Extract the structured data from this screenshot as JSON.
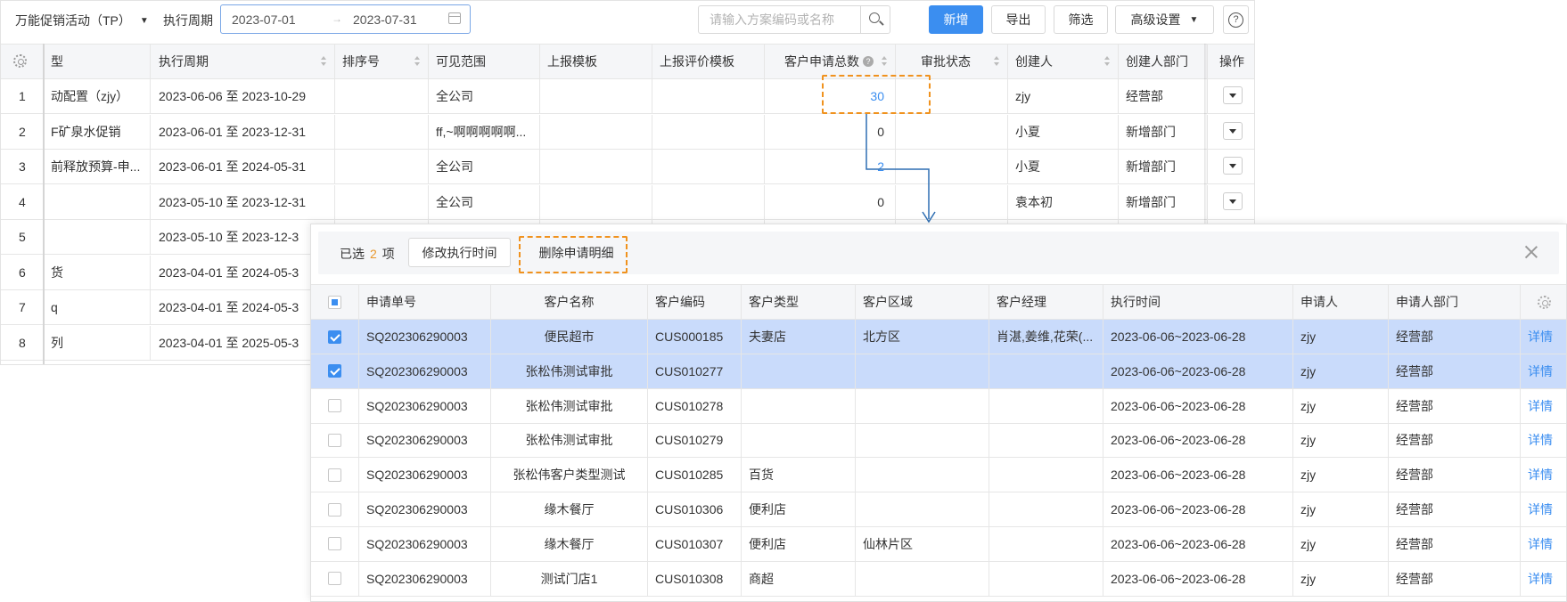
{
  "toolbar": {
    "activity_select": "万能促销活动（TP）",
    "period_label": "执行周期",
    "date_start": "2023-07-01",
    "date_arrow": "→",
    "date_end": "2023-07-31",
    "search_placeholder": "请输入方案编码或名称",
    "btn_new": "新增",
    "btn_export": "导出",
    "btn_filter": "筛选",
    "btn_advanced": "高级设置",
    "help_glyph": "?"
  },
  "main_table": {
    "columns": [
      "型",
      "执行周期",
      "排序号",
      "可见范围",
      "上报模板",
      "上报评价模板",
      "客户申请总数",
      "审批状态",
      "创建人",
      "创建人部门",
      "操作"
    ],
    "rows": [
      {
        "no": "1",
        "type": "动配置（zjy）",
        "period": "2023-06-06 至 2023-10-29",
        "sort": "",
        "scope": "全公司",
        "tpl": "",
        "eval_tpl": "",
        "total": "30",
        "status": "",
        "creator": "zjy",
        "dept": "经营部"
      },
      {
        "no": "2",
        "type": "F矿泉水促销",
        "period": "2023-06-01 至 2023-12-31",
        "sort": "",
        "scope": "ff,~啊啊啊啊啊...",
        "tpl": "",
        "eval_tpl": "",
        "total": "0",
        "status": "",
        "creator": "小夏",
        "dept": "新增部门"
      },
      {
        "no": "3",
        "type": "前释放预算-申...",
        "period": "2023-06-01 至 2024-05-31",
        "sort": "",
        "scope": "全公司",
        "tpl": "",
        "eval_tpl": "",
        "total": "2",
        "status": "",
        "creator": "小夏",
        "dept": "新增部门"
      },
      {
        "no": "4",
        "type": "",
        "period": "2023-05-10 至 2023-12-31",
        "sort": "",
        "scope": "全公司",
        "tpl": "",
        "eval_tpl": "",
        "total": "0",
        "status": "",
        "creator": "袁本初",
        "dept": "新增部门"
      },
      {
        "no": "5",
        "type": "",
        "period": "2023-05-10 至 2023-12-3",
        "sort": "",
        "scope": "",
        "tpl": "",
        "eval_tpl": "",
        "total": "",
        "status": "",
        "creator": "",
        "dept": ""
      },
      {
        "no": "6",
        "type": "货",
        "period": "2023-04-01 至 2024-05-3",
        "sort": "",
        "scope": "",
        "tpl": "",
        "eval_tpl": "",
        "total": "",
        "status": "",
        "creator": "",
        "dept": ""
      },
      {
        "no": "7",
        "type": "q",
        "period": "2023-04-01 至 2024-05-3",
        "sort": "",
        "scope": "",
        "tpl": "",
        "eval_tpl": "",
        "total": "",
        "status": "",
        "creator": "",
        "dept": ""
      },
      {
        "no": "8",
        "type": "列",
        "period": "2023-04-01 至 2025-05-3",
        "sort": "",
        "scope": "",
        "tpl": "",
        "eval_tpl": "",
        "total": "",
        "status": "",
        "creator": "",
        "dept": ""
      }
    ]
  },
  "batch_bar": {
    "selected_prefix": "已选",
    "selected_count": "2",
    "selected_suffix": "项",
    "btn_modify_time": "修改执行时间",
    "btn_delete_detail": "删除申请明细"
  },
  "detail_table": {
    "columns": [
      "申请单号",
      "客户名称",
      "客户编码",
      "客户类型",
      "客户区域",
      "客户经理",
      "执行时间",
      "申请人",
      "申请人部门"
    ],
    "rows": [
      {
        "checked": true,
        "no": "SQ202306290003",
        "name": "便民超市",
        "code": "CUS000185",
        "ctype": "夫妻店",
        "region": "北方区",
        "manager": "肖湛,姜维,花荣(...",
        "time": "2023-06-06~2023-06-28",
        "applicant": "zjy",
        "dept": "经营部",
        "action": "详情"
      },
      {
        "checked": true,
        "no": "SQ202306290003",
        "name": "张松伟测试审批",
        "code": "CUS010277",
        "ctype": "",
        "region": "",
        "manager": "",
        "time": "2023-06-06~2023-06-28",
        "applicant": "zjy",
        "dept": "经营部",
        "action": "详情"
      },
      {
        "checked": false,
        "no": "SQ202306290003",
        "name": "张松伟测试审批",
        "code": "CUS010278",
        "ctype": "",
        "region": "",
        "manager": "",
        "time": "2023-06-06~2023-06-28",
        "applicant": "zjy",
        "dept": "经营部",
        "action": "详情"
      },
      {
        "checked": false,
        "no": "SQ202306290003",
        "name": "张松伟测试审批",
        "code": "CUS010279",
        "ctype": "",
        "region": "",
        "manager": "",
        "time": "2023-06-06~2023-06-28",
        "applicant": "zjy",
        "dept": "经营部",
        "action": "详情"
      },
      {
        "checked": false,
        "no": "SQ202306290003",
        "name": "张松伟客户类型测试",
        "code": "CUS010285",
        "ctype": "百货",
        "region": "",
        "manager": "",
        "time": "2023-06-06~2023-06-28",
        "applicant": "zjy",
        "dept": "经营部",
        "action": "详情"
      },
      {
        "checked": false,
        "no": "SQ202306290003",
        "name": "缘木餐厅",
        "code": "CUS010306",
        "ctype": "便利店",
        "region": "",
        "manager": "",
        "time": "2023-06-06~2023-06-28",
        "applicant": "zjy",
        "dept": "经营部",
        "action": "详情"
      },
      {
        "checked": false,
        "no": "SQ202306290003",
        "name": "缘木餐厅",
        "code": "CUS010307",
        "ctype": "便利店",
        "region": "仙林片区",
        "manager": "",
        "time": "2023-06-06~2023-06-28",
        "applicant": "zjy",
        "dept": "经营部",
        "action": "详情"
      },
      {
        "checked": false,
        "no": "SQ202306290003",
        "name": "测试门店1",
        "code": "CUS010308",
        "ctype": "商超",
        "region": "",
        "manager": "",
        "time": "2023-06-06~2023-06-28",
        "applicant": "zjy",
        "dept": "经营部",
        "action": "详情"
      }
    ]
  },
  "colors": {
    "primary": "#3b8ef0",
    "selected_row": "#c9dbfb",
    "annotation": "#f0921e",
    "connector": "#2f6fb3",
    "count_highlight": "#e8962a"
  },
  "icons": [
    "caret-down-icon",
    "calendar-icon",
    "search-icon",
    "help-icon",
    "gear-icon",
    "sort-icon",
    "info-icon",
    "dropdown-icon",
    "close-icon",
    "checkbox-icon"
  ]
}
